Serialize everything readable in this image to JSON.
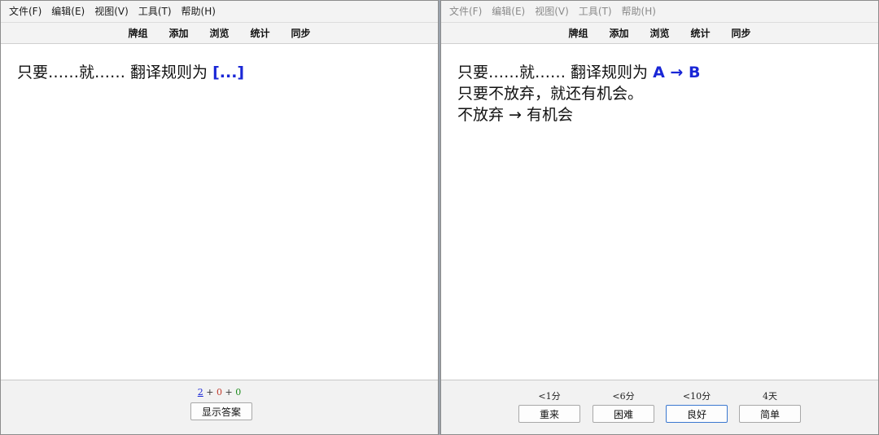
{
  "menu": {
    "file": "文件(F)",
    "edit": "编辑(E)",
    "view": "视图(V)",
    "tools": "工具(T)",
    "help": "帮助(H)"
  },
  "toolbar": {
    "decks": "牌组",
    "add": "添加",
    "browse": "浏览",
    "stats": "统计",
    "sync": "同步"
  },
  "question_card": {
    "prompt_text": "只要……就…… 翻译规则为 ",
    "cloze_placeholder": "[...]"
  },
  "answer_card": {
    "prompt_text": "只要……就…… 翻译规则为 ",
    "cloze_answer": "A → B",
    "line2": "只要不放弃，就还有机会。",
    "line3": "不放弃 → 有机会"
  },
  "due_counts": {
    "new": "2",
    "learning": "0",
    "review": "0",
    "separator": " + "
  },
  "show_answer_label": "显示答案",
  "answer_buttons": [
    {
      "interval": "<1分",
      "label": "重来"
    },
    {
      "interval": "<6分",
      "label": "困难"
    },
    {
      "interval": "<10分",
      "label": "良好"
    },
    {
      "interval": "4天",
      "label": "简单"
    }
  ]
}
